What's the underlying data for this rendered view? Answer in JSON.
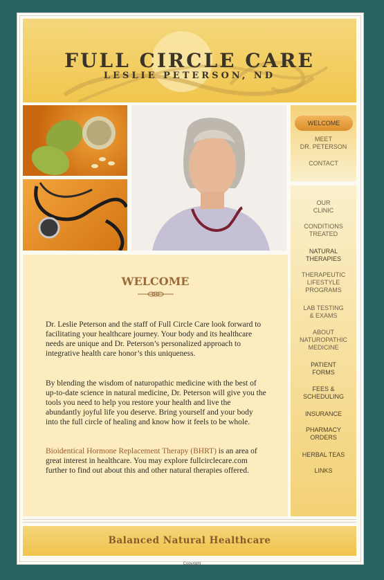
{
  "header": {
    "title": "FULL CIRCLE CARE",
    "subtitle": "LESLIE PETERSON, ND"
  },
  "nav_top": {
    "items": [
      {
        "label": "WELCOME",
        "active": true
      },
      {
        "label": "MEET\nDR. PETERSON"
      },
      {
        "label": "CONTACT"
      }
    ]
  },
  "nav_side": {
    "items": [
      {
        "label": "OUR\nCLINIC"
      },
      {
        "label": "CONDITIONS\nTREATED"
      },
      {
        "label": "NATURAL\nTHERAPIES"
      },
      {
        "label": "THERAPEUTIC\nLIFESTYLE\nPROGRAMS"
      },
      {
        "label": "LAB TESTING\n& EXAMS"
      },
      {
        "label": "ABOUT\nNATUROPATHIC\nMEDICINE"
      },
      {
        "label": "PATIENT\nFORMS"
      },
      {
        "label": "FEES &\nSCHEDULING"
      },
      {
        "label": "INSURANCE"
      },
      {
        "label": "PHARMACY\nORDERS"
      },
      {
        "label": "HERBAL TEAS"
      },
      {
        "label": "LINKS"
      }
    ]
  },
  "main": {
    "heading": "WELCOME",
    "para1": "Dr. Leslie Peterson and the staff of Full Circle Care look forward to facilitating your healthcare journey. Your body and its healthcare needs are unique and Dr. Peterson’s personalized approach to integrative health care honor’s this uniqueness.",
    "para2": "By blending the wisdom of naturopathic medicine with the best of up-to-date science in natural medicine, Dr. Peterson will give you the tools you need to help you restore your health and live the abundantly joyful life you deserve. Bring yourself and your body into the full circle of healing and know how it feels to be whole.",
    "para3_link": "Bioidentical Hormone Replacement Therapy (BHRT)",
    "para3_rest": " is an area of great interest in healthcare.  You may explore fullcirclecare.com further to find out about this and other natural therapies offered."
  },
  "footer": {
    "tagline": "Balanced Natural Healthcare",
    "copyright": "Copyright"
  },
  "colors": {
    "background": "#2a6462",
    "gold": "#f1c64e",
    "cream": "#fcecc0",
    "accent_brown": "#9a6b3a"
  }
}
